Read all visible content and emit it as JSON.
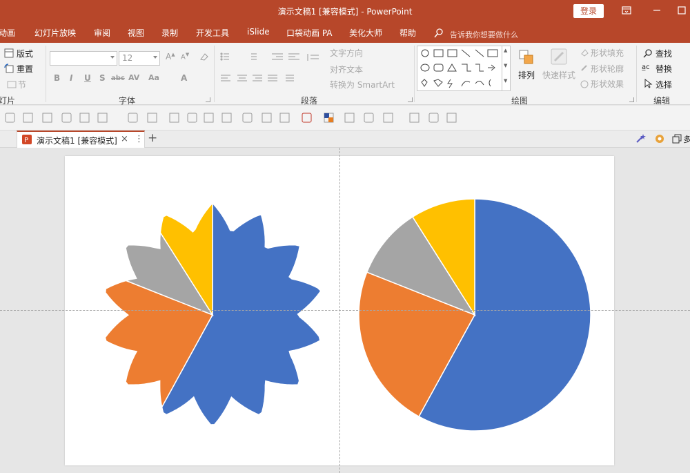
{
  "window": {
    "title": "演示文稿1 [兼容模式] - PowerPoint",
    "login_label": "登录",
    "accent_color": "#b7472a"
  },
  "ribbon_tabs": [
    "动画",
    "幻灯片放映",
    "审阅",
    "视图",
    "录制",
    "开发工具",
    "iSlide",
    "口袋动画 PA",
    "美化大师",
    "帮助"
  ],
  "tell_me": "告诉我你想要做什么",
  "ribbon": {
    "slides_group": {
      "layout_label": "版式",
      "reset_label": "重置",
      "section_label": "节",
      "group_label": "灯片"
    },
    "font_group": {
      "font_size_value": "12",
      "font_name_value": "",
      "format_buttons": [
        "B",
        "I",
        "U",
        "S",
        "abc",
        "AV",
        "Aa"
      ],
      "group_label": "字体"
    },
    "paragraph_group": {
      "text_direction_label": "文字方向",
      "align_text_label": "对齐文本",
      "smartart_label": "转换为 SmartArt",
      "group_label": "段落"
    },
    "drawing_group": {
      "arrange_label": "排列",
      "quick_styles_label": "快速样式",
      "shape_fill_label": "形状填充",
      "shape_outline_label": "形状轮廓",
      "shape_effects_label": "形状效果",
      "group_label": "绘图"
    },
    "editing_group": {
      "find_label": "查找",
      "replace_label": "替换",
      "select_label": "选择",
      "group_label": "编辑"
    }
  },
  "document_tab": {
    "name": "演示文稿1 [兼容模式]",
    "close_glyph": "×",
    "more_glyph": "⋮",
    "new_tab_glyph": "+",
    "right_text": "多"
  },
  "slide": {
    "star_chart": {
      "slices": [
        {
          "value": 58,
          "color": "#4472c4"
        },
        {
          "value": 23,
          "color": "#ed7d31"
        },
        {
          "value": 10,
          "color": "#a5a5a5"
        },
        {
          "value": 9,
          "color": "#ffc000"
        }
      ],
      "points": 14
    },
    "pie_chart": {
      "slices": [
        {
          "value": 58,
          "color": "#4472c4"
        },
        {
          "value": 23,
          "color": "#ed7d31"
        },
        {
          "value": 10,
          "color": "#a5a5a5"
        },
        {
          "value": 9,
          "color": "#ffc000"
        }
      ]
    }
  }
}
